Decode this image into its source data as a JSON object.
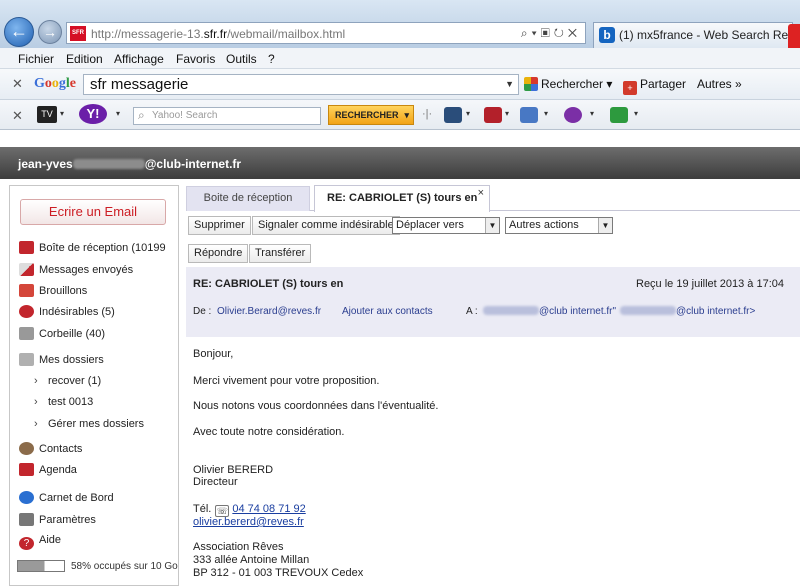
{
  "browser": {
    "url_prefix": "http://messagerie-13.",
    "url_domain": "sfr.fr",
    "url_path": "/webmail/mailbox.html",
    "sfr_favicon": "SFR",
    "tab_title": "(1) mx5france - Web Search Re...",
    "tab_favicon": "b",
    "menu": [
      "Fichier",
      "Edition",
      "Affichage",
      "Favoris",
      "Outils",
      "?"
    ],
    "google_toolbar": {
      "logo": "Google",
      "search_value": "sfr messagerie",
      "rechercher": "Rechercher",
      "partager": "Partager",
      "autres": "Autres »"
    },
    "yahoo_toolbar": {
      "search_placeholder": "Yahoo! Search",
      "rechercher": "RECHERCHER",
      "tv_label": "TV"
    }
  },
  "mail": {
    "user_prefix": "jean-yves",
    "user_suffix": "@club-internet.fr",
    "compose": "Ecrire un Email",
    "folders": [
      {
        "label": "Boîte de réception",
        "count": "(10199"
      },
      {
        "label": "Messages envoyés",
        "count": ""
      },
      {
        "label": "Brouillons",
        "count": ""
      },
      {
        "label": "Indésirables",
        "count": "(5)"
      },
      {
        "label": "Corbeille",
        "count": "(40)"
      },
      {
        "label": "Mes dossiers",
        "count": ""
      }
    ],
    "subfolders": [
      {
        "label": "recover",
        "count": "(1)"
      },
      {
        "label": "test 0013",
        "count": ""
      },
      {
        "label": "Gérer mes dossiers",
        "count": ""
      }
    ],
    "bottom_links": [
      "Contacts",
      "Agenda",
      "Carnet de Bord",
      "Paramètres",
      "Aide"
    ],
    "quota": {
      "text": "58% occupés sur 10 Go",
      "fraction": 0.58
    },
    "tabs": {
      "inbox": "Boite de réception",
      "message": "RE: CABRIOLET (S) tours en",
      "close": "×"
    },
    "actions": {
      "delete": "Supprimer",
      "spam": "Signaler comme indésirable",
      "move": "Déplacer vers",
      "other": "Autres actions",
      "reply": "Répondre",
      "forward": "Transférer"
    },
    "message": {
      "subject": "RE: CABRIOLET (S) tours en",
      "received": "Reçu le 19 juillet 2013 à 17:04",
      "from_label": "De :",
      "from": "Olivier.Berard@reves.fr",
      "add_contact": "Ajouter aux contacts",
      "to_label": "A :",
      "to_1": "@club internet.fr\"",
      "to_2": "@club internet.fr>",
      "body": {
        "greeting": "Bonjour,",
        "line1": "Merci vivement pour votre proposition.",
        "line2": "Nous notons vous coordonnées dans l'éventualité.",
        "line3": "Avec toute notre considération.",
        "sig_name": "Olivier BERERD",
        "sig_title": "Directeur",
        "tel_label": "Tél.",
        "tel": "04 74 08 71 92",
        "email": "olivier.bererd@reves.fr",
        "org": "Association Rêves",
        "addr1": "333 allée Antoine Millan",
        "addr2": "BP 312 - 01 003 TREVOUX Cedex"
      }
    }
  },
  "colors": {
    "compose_red": "#cc1d24",
    "link_blue": "#2a3d8f",
    "header_bg": "#ebebf5"
  }
}
